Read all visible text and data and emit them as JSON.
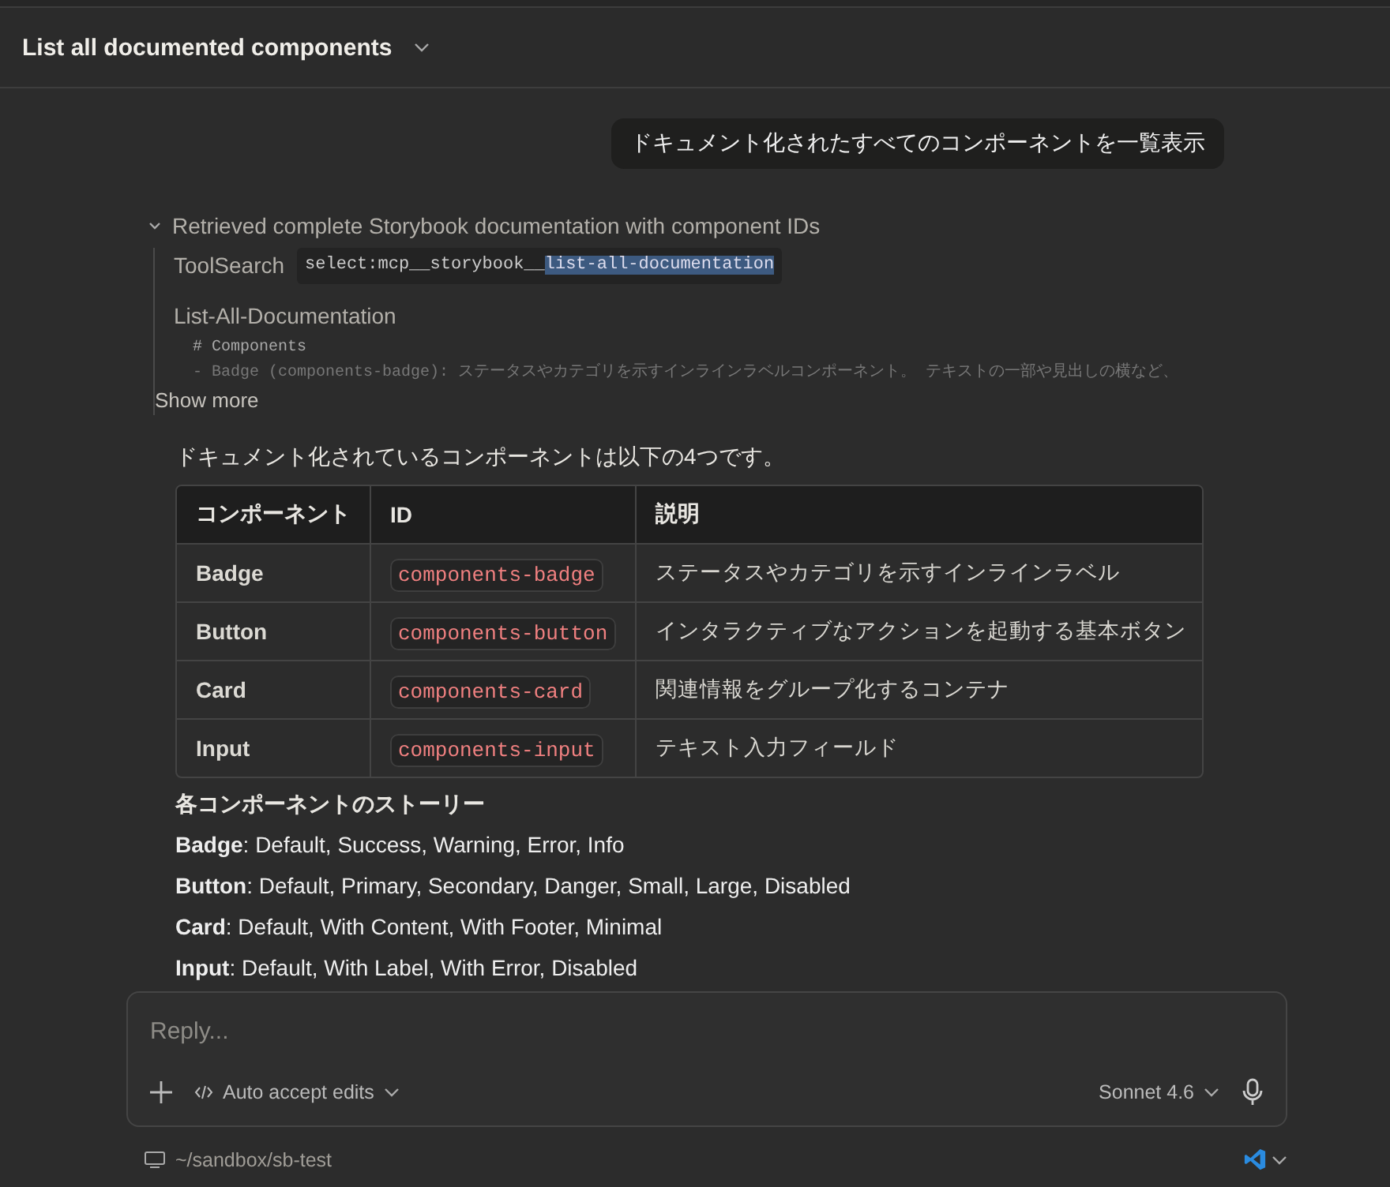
{
  "header": {
    "title": "List all documented components"
  },
  "user_message": "ドキュメント化されたすべてのコンポーネントを一覧表示",
  "tool_group": {
    "summary": "Retrieved complete Storybook documentation with component IDs",
    "expanded": true,
    "steps": [
      {
        "kind": "search",
        "name": "ToolSearch",
        "query": [
          {
            "text": "select:mcp__storybook__",
            "selected": false
          },
          {
            "text": "list-all-documentation",
            "selected": true
          }
        ]
      },
      {
        "kind": "output",
        "name": "List-All-Documentation",
        "lines": [
          "# Components",
          "- Badge (components-badge): ステータスやカテゴリを示すインラインラベルコンポーネント。 テキストの一部や見出しの横など、"
        ],
        "more": "Show more"
      }
    ]
  },
  "answer": {
    "intro": "ドキュメント化されているコンポーネントは以下の4つです。",
    "table": {
      "columns": [
        "コンポーネント",
        "ID",
        "説明"
      ],
      "rows": [
        [
          "Badge",
          "components-badge",
          "ステータスやカテゴリを示すインラインラベル"
        ],
        [
          "Button",
          "components-button",
          "インタラクティブなアクションを起動する基本ボタン"
        ],
        [
          "Card",
          "components-card",
          "関連情報をグループ化するコンテナ"
        ],
        [
          "Input",
          "components-input",
          "テキスト入力フィールド"
        ]
      ]
    },
    "stories_heading": "各コンポーネントのストーリー",
    "stories": [
      "**Badge**: Default, Success, Warning, Error, Info",
      "**Button**: Default, Primary, Secondary, Danger, Small, Large, Disabled",
      "**Card**: Default, With Content, With Footer, Minimal",
      "**Input**: Default, With Label, With Error, Disabled"
    ]
  },
  "composer": {
    "placeholder": "Reply...",
    "mode": "Auto accept edits",
    "model": "Sonnet 4.6"
  },
  "footer": {
    "path": "~/sandbox/sb-test"
  }
}
